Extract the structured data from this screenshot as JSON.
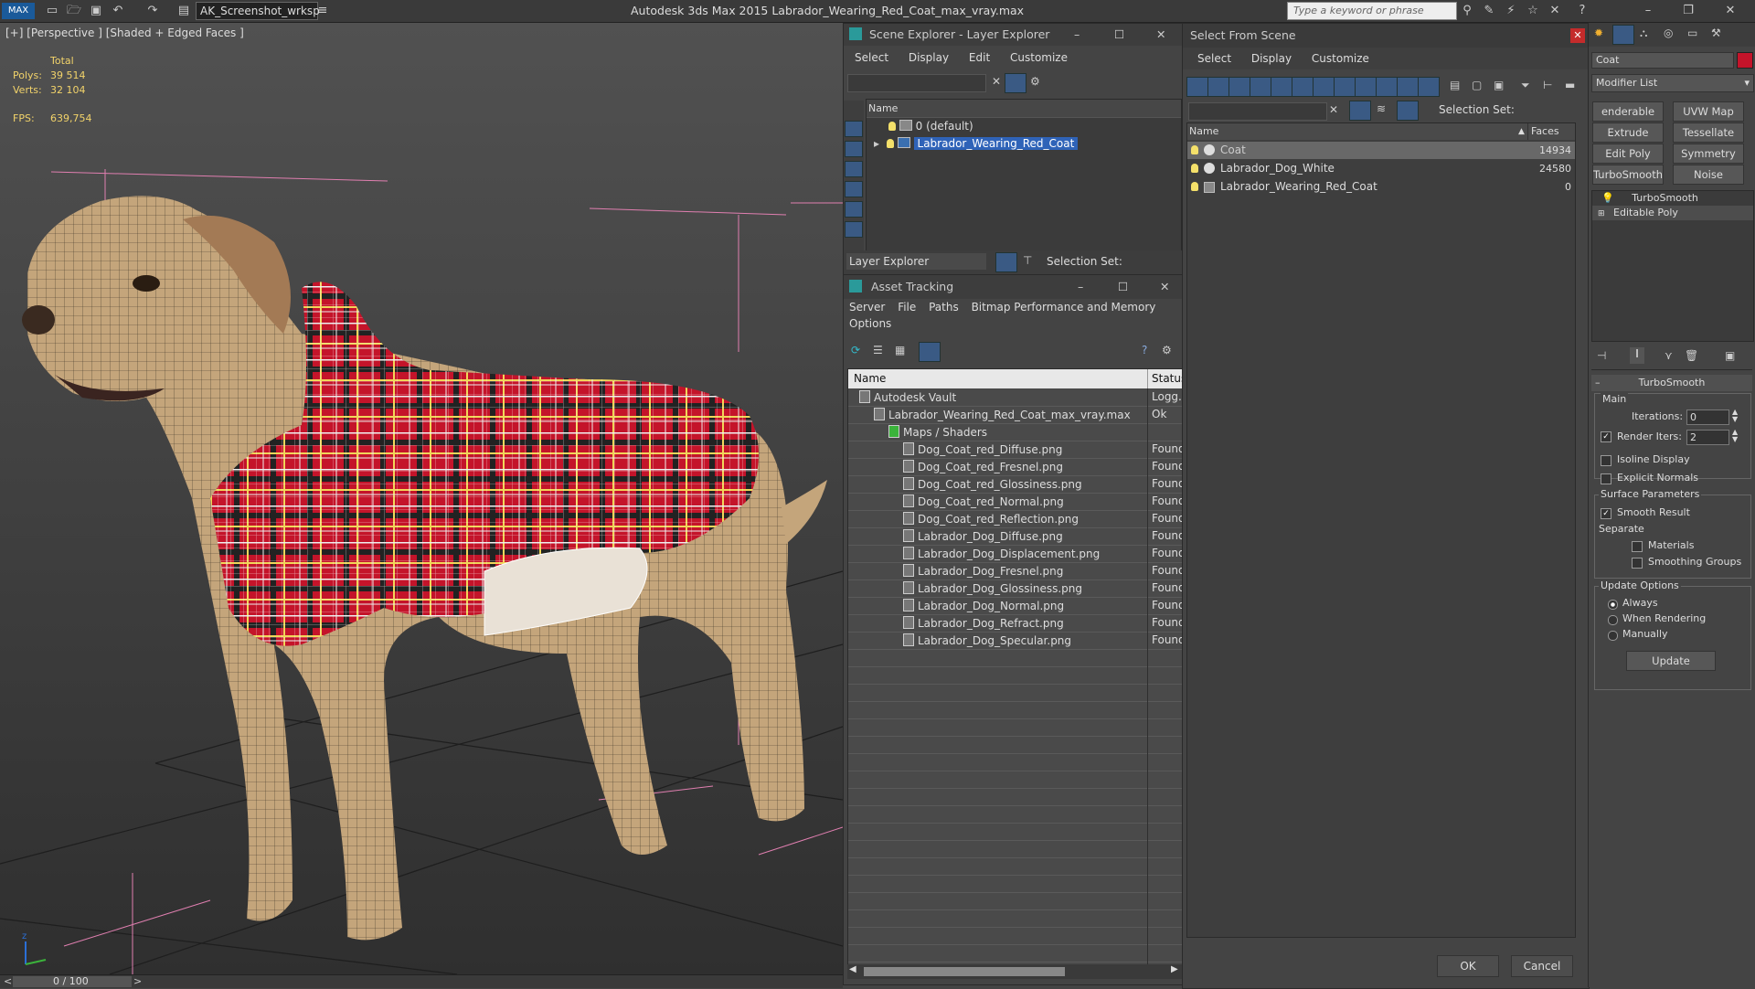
{
  "titlebar": {
    "workspace": "AK_Screenshot_wrksp",
    "app_title": "Autodesk 3ds Max  2015    Labrador_Wearing_Red_Coat_max_vray.max",
    "search_placeholder": "Type a keyword or phrase"
  },
  "viewport": {
    "label": "[+] [Perspective ] [Shaded + Edged Faces ]",
    "stats": {
      "total_label": "Total",
      "polys_label": "Polys:",
      "polys_value": "39 514",
      "verts_label": "Verts:",
      "verts_value": "32 104",
      "fps_label": "FPS:",
      "fps_value": "639,754"
    },
    "timeline": "0 / 100"
  },
  "scene_explorer": {
    "title": "Scene Explorer - Layer Explorer",
    "menu": [
      "Select",
      "Display",
      "Edit",
      "Customize"
    ],
    "column_name": "Name",
    "layers": [
      "0 (default)",
      "Labrador_Wearing_Red_Coat"
    ],
    "footer_mode": "Layer Explorer",
    "selection_set_label": "Selection Set:"
  },
  "asset_tracking": {
    "title": "Asset Tracking",
    "menu": [
      "Server",
      "File",
      "Paths",
      "Bitmap Performance and Memory"
    ],
    "menu_row2": "Options",
    "col_name": "Name",
    "col_status": "Status",
    "rows": [
      {
        "name": "Autodesk Vault",
        "status": "Logg...",
        "indent": 0
      },
      {
        "name": "Labrador_Wearing_Red_Coat_max_vray.max",
        "status": "Ok",
        "indent": 1
      },
      {
        "name": "Maps / Shaders",
        "status": "",
        "indent": 2
      },
      {
        "name": "Dog_Coat_red_Diffuse.png",
        "status": "Found",
        "indent": 3
      },
      {
        "name": "Dog_Coat_red_Fresnel.png",
        "status": "Found",
        "indent": 3
      },
      {
        "name": "Dog_Coat_red_Glossiness.png",
        "status": "Found",
        "indent": 3
      },
      {
        "name": "Dog_Coat_red_Normal.png",
        "status": "Found",
        "indent": 3
      },
      {
        "name": "Dog_Coat_red_Reflection.png",
        "status": "Found",
        "indent": 3
      },
      {
        "name": "Labrador_Dog_Diffuse.png",
        "status": "Found",
        "indent": 3
      },
      {
        "name": "Labrador_Dog_Displacement.png",
        "status": "Found",
        "indent": 3
      },
      {
        "name": "Labrador_Dog_Fresnel.png",
        "status": "Found",
        "indent": 3
      },
      {
        "name": "Labrador_Dog_Glossiness.png",
        "status": "Found",
        "indent": 3
      },
      {
        "name": "Labrador_Dog_Normal.png",
        "status": "Found",
        "indent": 3
      },
      {
        "name": "Labrador_Dog_Refract.png",
        "status": "Found",
        "indent": 3
      },
      {
        "name": "Labrador_Dog_Specular.png",
        "status": "Found",
        "indent": 3
      }
    ]
  },
  "select_from_scene": {
    "title": "Select From Scene",
    "menu": [
      "Select",
      "Display",
      "Customize"
    ],
    "selection_set_label": "Selection Set:",
    "col_name": "Name",
    "col_faces": "Faces",
    "rows": [
      {
        "name": "Coat",
        "faces": "14934"
      },
      {
        "name": "Labrador_Dog_White",
        "faces": "24580"
      },
      {
        "name": "Labrador_Wearing_Red_Coat",
        "faces": "0"
      }
    ],
    "ok_label": "OK",
    "cancel_label": "Cancel"
  },
  "command_panel": {
    "object_name": "Coat",
    "modifier_list": "Modifier List",
    "buttons": [
      "enderable Splin",
      "UVW Map",
      "Extrude",
      "Tessellate",
      "Edit Poly",
      "Symmetry",
      "TurboSmooth",
      "Noise"
    ],
    "stack": [
      "TurboSmooth",
      "Editable Poly"
    ],
    "rollout_title": "TurboSmooth",
    "main_label": "Main",
    "iterations_label": "Iterations:",
    "iterations_value": "0",
    "render_iters_label": "Render Iters:",
    "render_iters_value": "2",
    "isoline_label": "Isoline Display",
    "explicit_normals_label": "Explicit Normals",
    "surface_params_label": "Surface Parameters",
    "smooth_result_label": "Smooth Result",
    "separate_label": "Separate",
    "materials_label": "Materials",
    "smoothing_groups_label": "Smoothing Groups",
    "update_options_label": "Update Options",
    "always_label": "Always",
    "when_rendering_label": "When Rendering",
    "manually_label": "Manually",
    "update_button": "Update"
  },
  "colors": {
    "accent_blue": "#3a6fb0",
    "selection_highlight": "#2f63b8",
    "stat_yellow": "#f2d36a",
    "coat_red": "#c4142a"
  }
}
